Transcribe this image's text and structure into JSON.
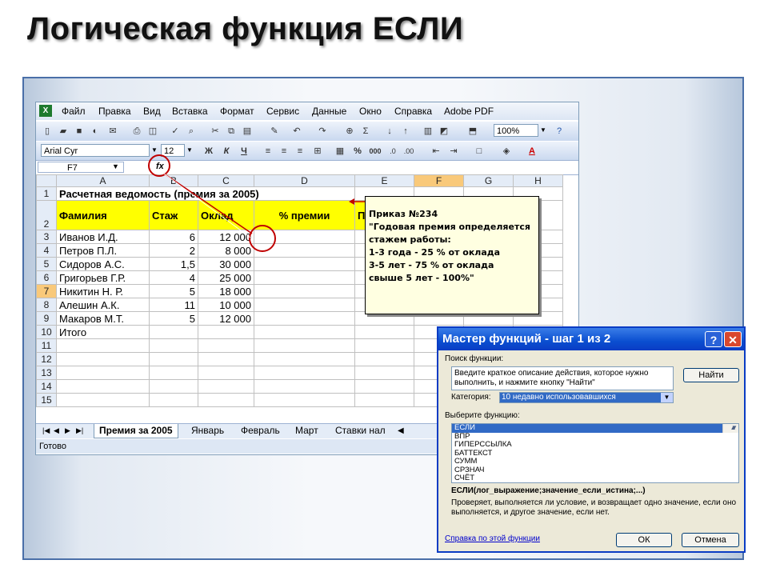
{
  "slide_title": "Логическая функция ЕСЛИ",
  "menu": [
    "Файл",
    "Правка",
    "Вид",
    "Вставка",
    "Формат",
    "Сервис",
    "Данные",
    "Окно",
    "Справка",
    "Adobe PDF"
  ],
  "zoom": "100%",
  "font_name": "Arial Cyr",
  "font_size": "12",
  "format_buttons": {
    "bold": "Ж",
    "italic": "К",
    "underline": "Ч",
    "percent": "%",
    "thousands": "000"
  },
  "name_box": "F7",
  "fx_label": "fx",
  "columns": [
    "A",
    "B",
    "C",
    "D",
    "E",
    "F",
    "G",
    "H"
  ],
  "rows": [
    {
      "n": "1",
      "a": "Расчетная ведомость (премия за 2005)",
      "b": "",
      "c": "",
      "d": ""
    },
    {
      "n": "2",
      "a": "Фамилия",
      "b": "Стаж",
      "c": "Оклад",
      "d": "% премии",
      "e": "П"
    },
    {
      "n": "3",
      "a": "Иванов И.Д.",
      "b": "6",
      "c": "12 000",
      "d": ""
    },
    {
      "n": "4",
      "a": "Петров П.Л.",
      "b": "2",
      "c": "8 000",
      "d": ""
    },
    {
      "n": "5",
      "a": "Сидоров А.С.",
      "b": "1,5",
      "c": "30 000",
      "d": ""
    },
    {
      "n": "6",
      "a": "Григорьев Г.Р.",
      "b": "4",
      "c": "25 000",
      "d": ""
    },
    {
      "n": "7",
      "a": "Никитин Н. Р.",
      "b": "5",
      "c": "18 000",
      "d": ""
    },
    {
      "n": "8",
      "a": "Алешин А.К.",
      "b": "11",
      "c": "10 000",
      "d": ""
    },
    {
      "n": "9",
      "a": "Макаров М.Т.",
      "b": "5",
      "c": "12 000",
      "d": ""
    },
    {
      "n": "10",
      "a": "Итого",
      "b": "",
      "c": "",
      "d": ""
    },
    {
      "n": "11",
      "a": "",
      "b": "",
      "c": "",
      "d": ""
    },
    {
      "n": "12",
      "a": "",
      "b": "",
      "c": "",
      "d": ""
    },
    {
      "n": "13",
      "a": "",
      "b": "",
      "c": "",
      "d": ""
    },
    {
      "n": "14",
      "a": "",
      "b": "",
      "c": "",
      "d": ""
    },
    {
      "n": "15",
      "a": "",
      "b": "",
      "c": "",
      "d": ""
    }
  ],
  "sheet_tabs": [
    "Премия за 2005",
    "Январь",
    "Февраль",
    "Март",
    "Ставки нал"
  ],
  "status": "Готово",
  "note_lines": [
    "Приказ №234",
    "\"Годовая премия определяется",
    "стажем работы:",
    "1-3 года  - 25 % от оклада",
    "3-5 лет  - 75 % от оклада",
    "свыше 5 лет - 100%\""
  ],
  "wizard": {
    "title": "Мастер функций - шаг 1 из 2",
    "help_btn": "?",
    "close_btn": "✕",
    "search_label": "Поиск функции:",
    "search_text": "Введите краткое описание действия, которое нужно выполнить, и нажмите кнопку \"Найти\"",
    "find_btn": "Найти",
    "category_label": "Категория:",
    "category_value": "10 недавно использовавшихся",
    "choose_label": "Выберите функцию:",
    "functions": [
      "ЕСЛИ",
      "ВПР",
      "ГИПЕРССЫЛКА",
      "БАТТЕКСТ",
      "СУММ",
      "СРЗНАЧ",
      "СЧЁТ"
    ],
    "signature": "ЕСЛИ(лог_выражение;значение_если_истина;...)",
    "description": "Проверяет, выполняется ли условие, и возвращает одно значение, если оно выполняется, и другое значение, если нет.",
    "help_link": "Справка по этой функции",
    "ok_btn": "ОК",
    "cancel_btn": "Отмена"
  },
  "colors": {
    "header_yellow": "#ffff00",
    "note_bg": "#ffffe1",
    "title_bar": "#0a4ed0",
    "selection": "#f9c97a",
    "callout_red": "#c00000"
  }
}
